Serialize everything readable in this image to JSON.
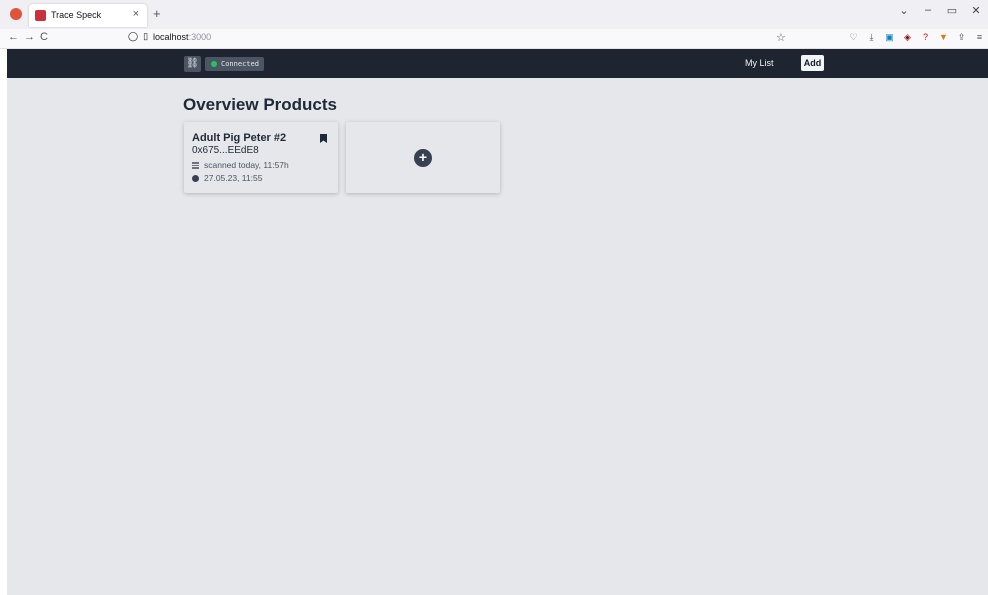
{
  "browser": {
    "tab_title": "Trace Speck",
    "tab_close": "×",
    "new_tab": "+",
    "url_host": "localhost",
    "url_port": ":3000",
    "nav": {
      "back": "←",
      "forward": "→",
      "reload": "C"
    },
    "window": {
      "minimize": "–",
      "restore": "▭",
      "close": "✕"
    },
    "extension_icons": [
      "pocket-icon",
      "download-icon",
      "bookmark-list-icon",
      "ublock-icon",
      "help-icon",
      "fox-icon",
      "share-icon",
      "menu-icon"
    ]
  },
  "header": {
    "status": "Connected",
    "status_color": "#22c55e",
    "nav_mylist": "My List",
    "add_label": "Add"
  },
  "main": {
    "title": "Overview Products",
    "products": [
      {
        "name": "Adult Pig Peter #2",
        "address": "0x675...EEdE8",
        "scanned": "scanned today, 11:57h",
        "date": "27.05.23, 11:55"
      }
    ],
    "add_symbol": "+"
  },
  "colors": {
    "header_bg": "#1e2430",
    "content_bg": "#e5e7eb",
    "text_dark": "#1f2937"
  }
}
